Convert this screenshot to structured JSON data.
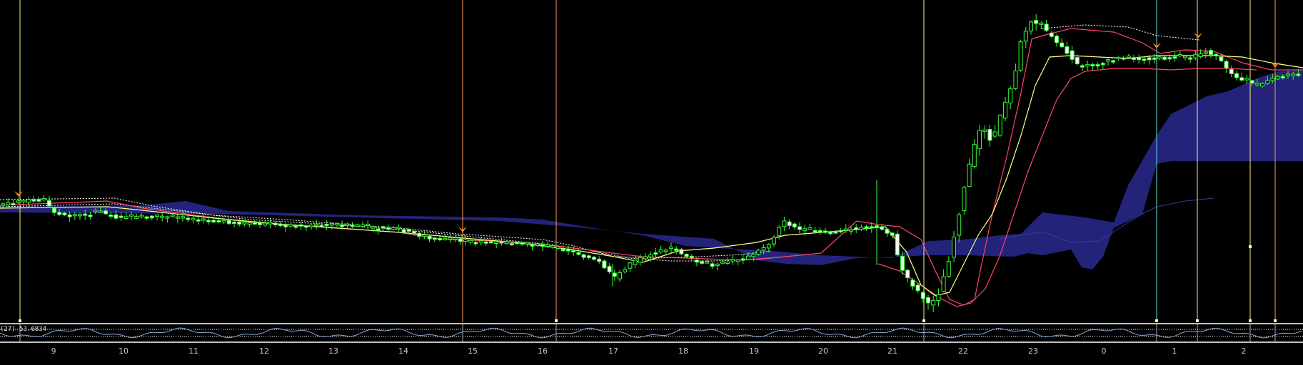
{
  "colors": {
    "background": "#000000",
    "bull_candle": "#33ff33",
    "bear_candle": "#ffffff",
    "cloud": "#23237a",
    "kijun_line": "#ff4466",
    "tenkan_line": "#ffff88",
    "span_dashed": "#ffffff",
    "vline_orange": "#ff9955",
    "vline_yellow": "#ffee88",
    "vline_cyan": "#66dddd",
    "marker": "#ff8800"
  },
  "indicator": {
    "label": "(27) 53.6834"
  },
  "time_axis": {
    "labels": [
      "9",
      "10",
      "11",
      "12",
      "13",
      "14",
      "15",
      "16",
      "17",
      "18",
      "19",
      "20",
      "21",
      "22",
      "23",
      "0",
      "1",
      "2"
    ]
  }
}
